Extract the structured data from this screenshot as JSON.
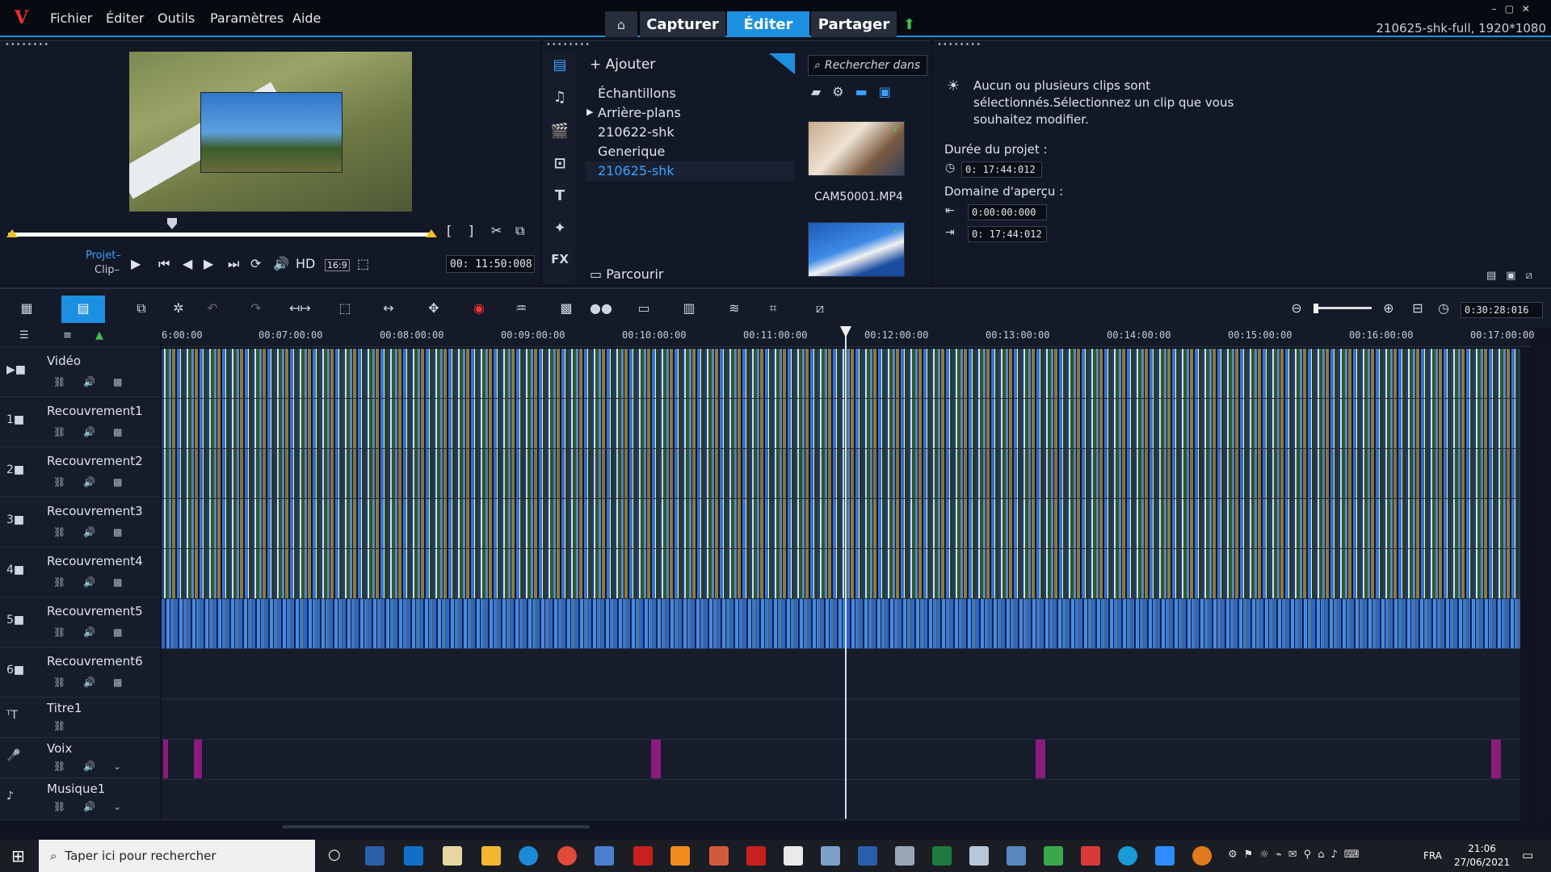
{
  "menu": [
    "Fichier",
    "Éditer",
    "Outils",
    "Paramètres",
    "Aide"
  ],
  "workspace_tabs": {
    "capture": "Capturer",
    "edit": "Éditer",
    "share": "Partager"
  },
  "project_info": "210625-shk-full, 1920*1080",
  "player": {
    "mode_project": "Projet–",
    "mode_clip": "Clip–",
    "quality": "HD",
    "aspect": "16:9",
    "timecode": "00: 11:50:008"
  },
  "library": {
    "add": "Ajouter",
    "folders": [
      "Échantillons",
      "Arrière-plans",
      "210622-shk",
      "Generique",
      "210625-shk"
    ],
    "browse": "Parcourir",
    "search_placeholder": "Rechercher dans",
    "thumb1_name": "CAM50001.MP4"
  },
  "options": {
    "info": "Aucun ou plusieurs clips sont sélectionnés.Sélectionnez un clip que vous souhaitez modifier.",
    "duration_label": "Durée du projet :",
    "duration": "0: 17:44:012",
    "range_label": "Domaine d'aperçu :",
    "range_start": "0:00:00:000",
    "range_end": "0: 17:44:012"
  },
  "timeline": {
    "total": "0:30:28:016",
    "ticks": [
      "6:00:00",
      "00:07:00:00",
      "00:08:00:00",
      "00:09:00:00",
      "00:10:00:00",
      "00:11:00:00",
      "00:12:00:00",
      "00:13:00:00",
      "00:14:00:00",
      "00:15:00:00",
      "00:16:00:00",
      "00:17:00:00"
    ],
    "tracks": [
      "Vidéo",
      "Recouvrement1",
      "Recouvrement2",
      "Recouvrement3",
      "Recouvrement4",
      "Recouvrement5",
      "Recouvrement6",
      "Titre1",
      "Voix",
      "Musique1"
    ]
  },
  "taskbar": {
    "search": "Taper ici pour rechercher",
    "lang": "FRA",
    "time": "21:06",
    "date": "27/06/2021"
  },
  "colors": {
    "accent": "#1d8fe0",
    "voice": "#8a1c7c"
  }
}
